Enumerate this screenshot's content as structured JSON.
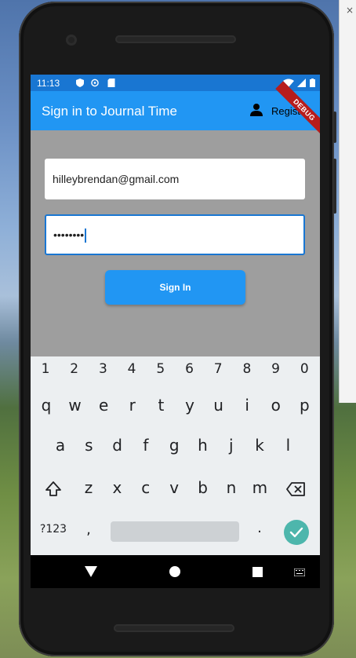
{
  "status_bar": {
    "time": "11:13"
  },
  "app_bar": {
    "title": "Sign in to Journal Time",
    "register_label": "Register",
    "debug_banner": "DEBUG"
  },
  "form": {
    "email_value": "hilleybrendan@gmail.com",
    "password_value": "••••••••",
    "sign_in_label": "Sign In"
  },
  "keyboard": {
    "number_row": [
      "1",
      "2",
      "3",
      "4",
      "5",
      "6",
      "7",
      "8",
      "9",
      "0"
    ],
    "row1": [
      "q",
      "w",
      "e",
      "r",
      "t",
      "y",
      "u",
      "i",
      "o",
      "p"
    ],
    "row2": [
      "a",
      "s",
      "d",
      "f",
      "g",
      "h",
      "j",
      "k",
      "l"
    ],
    "row3": [
      "z",
      "x",
      "c",
      "v",
      "b",
      "n",
      "m"
    ],
    "symbols_label": "?123",
    "comma": ",",
    "period": "."
  },
  "colors": {
    "app_bar": "#2196f3",
    "status_bar": "#1976d2",
    "body": "#9e9e9e",
    "keyboard": "#eceff1",
    "enter": "#4db6ac"
  }
}
